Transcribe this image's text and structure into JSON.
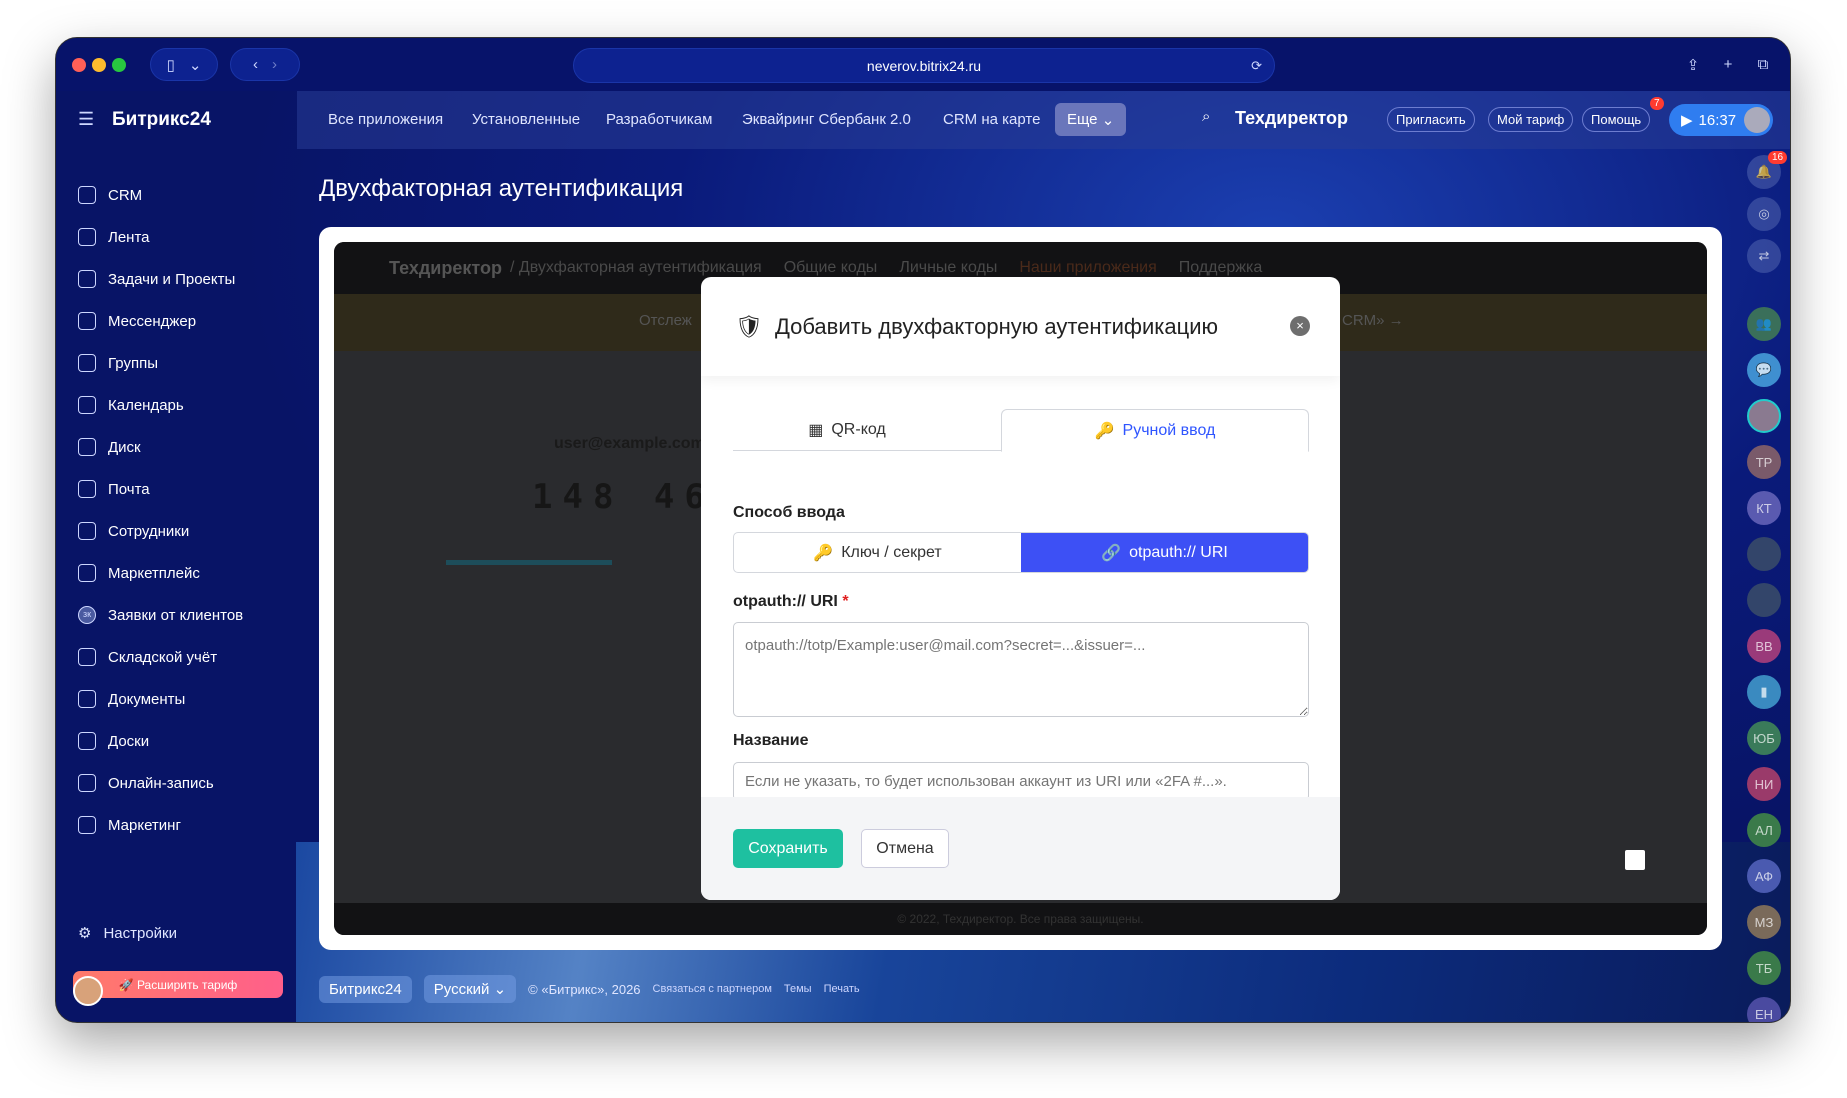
{
  "browser": {
    "url": "neverov.bitrix24.ru"
  },
  "sidebar": {
    "logo": "Битрикс24",
    "items": [
      {
        "label": "CRM",
        "icon": "crm-icon"
      },
      {
        "label": "Лента",
        "icon": "feed-icon"
      },
      {
        "label": "Задачи и Проекты",
        "icon": "tasks-icon"
      },
      {
        "label": "Мессенджер",
        "icon": "messenger-icon"
      },
      {
        "label": "Группы",
        "icon": "groups-icon"
      },
      {
        "label": "Календарь",
        "icon": "calendar-icon"
      },
      {
        "label": "Диск",
        "icon": "disk-icon"
      },
      {
        "label": "Почта",
        "icon": "mail-icon"
      },
      {
        "label": "Сотрудники",
        "icon": "employees-icon"
      },
      {
        "label": "Маркетплейс",
        "icon": "marketplace-icon"
      },
      {
        "label": "Заявки от клиентов",
        "icon": "зк"
      },
      {
        "label": "Складской учёт",
        "icon": "warehouse-icon"
      },
      {
        "label": "Документы",
        "icon": "documents-icon"
      },
      {
        "label": "Доски",
        "icon": "boards-icon"
      },
      {
        "label": "Онлайн-запись",
        "icon": "booking-icon"
      },
      {
        "label": "Маркетинг",
        "icon": "marketing-icon"
      }
    ],
    "settings": "Настройки",
    "upgrade": "Расширить тариф"
  },
  "topbar": {
    "links": [
      "Все приложения",
      "Установленные",
      "Разработчикам",
      "Эквайринг Сбербанк 2.0",
      "CRM на карте"
    ],
    "more": "Еще",
    "company": "Техдиректор",
    "invite": "Пригласить",
    "plan": "Мой тариф",
    "help": "Помощь",
    "help_badge": "7",
    "time": "16:37"
  },
  "page": {
    "title": "Двухфакторная аутентификация"
  },
  "app": {
    "brand": "Техдиректор",
    "breadcrumb": "/ Двухфакторная аутентификация",
    "nav": [
      "Общие коды",
      "Личные коды",
      "Наши приложения",
      "Поддержка"
    ],
    "banner_left": "Отслеж",
    "banner_right": "CRM» →",
    "email": "user@example.com",
    "code": "148 469",
    "footer": "© 2022, Техдиректор. Все права защищены."
  },
  "modal": {
    "title": "Добавить двухфакторную аутентификацию",
    "tabs": {
      "qr": "QR-код",
      "manual": "Ручной ввод",
      "active": "manual"
    },
    "method_label": "Способ ввода",
    "method_key": "Ключ / секрет",
    "method_uri": "otpauth:// URI",
    "method_active": "uri",
    "uri_label": "otpauth:// URI",
    "required_mark": "*",
    "uri_placeholder": "otpauth://totp/Example:user@mail.com?secret=...&issuer=...",
    "name_label": "Название",
    "name_placeholder": "Если не указать, то будет использован аккаунт из URI или «2FA #...».",
    "save": "Сохранить",
    "cancel": "Отмена"
  },
  "rightbar": {
    "notif_badge": "16",
    "avatars": [
      "ТР",
      "КТ",
      "ВВ",
      "ЮБ",
      "НИ",
      "АЛ",
      "АФ",
      "МЗ",
      "ТБ",
      "ЕН"
    ]
  },
  "footer": {
    "brand": "Битрикс24",
    "lang": "Русский",
    "copyright": "© «Битрикс», 2026",
    "partner": "Связаться с партнером",
    "themes": "Темы",
    "print": "Печать"
  },
  "colors": {
    "accent": "#3d50f5",
    "save": "#1ec0a0",
    "clock": "#2f7df0"
  }
}
